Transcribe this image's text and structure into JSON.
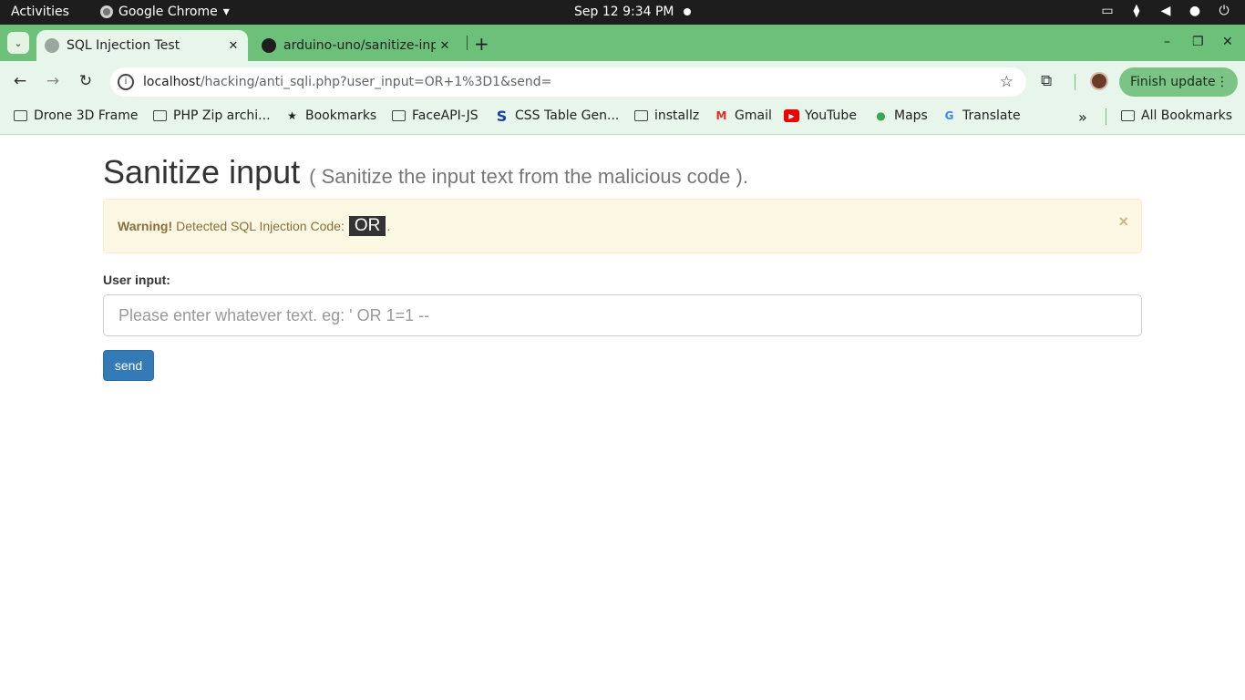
{
  "topbar": {
    "activities": "Activities",
    "app_name": "Google Chrome",
    "app_arrow": "▾",
    "clock": "Sep 12  9:34 PM"
  },
  "tabs": [
    {
      "title": "SQL Injection Test",
      "close": "✕"
    },
    {
      "title": "arduino-uno/sanitize-inp",
      "close": "✕"
    }
  ],
  "tab_search_icon": "⌄",
  "new_tab": "+",
  "window_controls": {
    "minimize": "–",
    "restore": "❐",
    "close": "✕"
  },
  "toolbar": {
    "back": "←",
    "forward": "→",
    "reload": "↻",
    "url_host": "localhost",
    "url_path": "/hacking/anti_sqli.php?user_input=OR+1%3D1&send=",
    "star": "☆",
    "extensions": "⧉",
    "finish_update": "Finish update",
    "menu": "⋮"
  },
  "bookmarks": [
    {
      "label": "Drone 3D Frame",
      "icon": "folder-icon"
    },
    {
      "label": "PHP Zip archi...",
      "icon": "folder-icon"
    },
    {
      "label": "Bookmarks",
      "icon": "star-icon"
    },
    {
      "label": "FaceAPI-JS",
      "icon": "folder-icon"
    },
    {
      "label": "CSS Table Gen...",
      "icon": "s-icon"
    },
    {
      "label": "installz",
      "icon": "folder-icon"
    },
    {
      "label": "Gmail",
      "icon": "gmail-icon"
    },
    {
      "label": "YouTube",
      "icon": "youtube-icon"
    },
    {
      "label": "Maps",
      "icon": "maps-icon"
    },
    {
      "label": "Translate",
      "icon": "translate-icon"
    }
  ],
  "bookmarks_overflow": "»",
  "all_bookmarks": "All Bookmarks",
  "page": {
    "title": "Sanitize input",
    "subtitle": "( Sanitize the input text from the malicious code ).",
    "alert": {
      "strong": "Warning!",
      "message": "Detected SQL Injection Code:",
      "code": "OR",
      "end": ".",
      "close": "×"
    },
    "input_label": "User input:",
    "input_placeholder": "Please enter whatever text. eg: ' OR 1=1 --",
    "input_value": "",
    "send_label": "send"
  },
  "colors": {
    "tabstrip": "#6cc07a",
    "toolbar": "#e8f5ea",
    "alert_bg": "#fcf8e3",
    "alert_text": "#8a6d3b",
    "button": "#337ab7"
  }
}
